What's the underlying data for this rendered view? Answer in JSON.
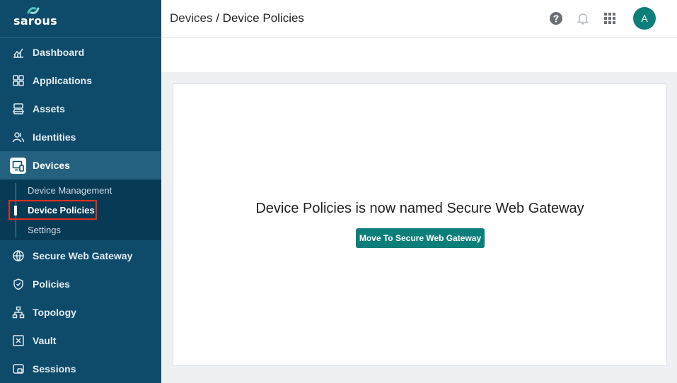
{
  "brand": {
    "name": "sarous"
  },
  "sidebar": {
    "items": [
      {
        "label": "Dashboard",
        "icon": "chart-icon"
      },
      {
        "label": "Applications",
        "icon": "grid-icon"
      },
      {
        "label": "Assets",
        "icon": "server-icon"
      },
      {
        "label": "Identities",
        "icon": "users-icon"
      },
      {
        "label": "Devices",
        "icon": "device-icon",
        "active": true
      },
      {
        "label": "Secure Web Gateway",
        "icon": "globe-icon"
      },
      {
        "label": "Policies",
        "icon": "shield-icon"
      },
      {
        "label": "Topology",
        "icon": "topology-icon"
      },
      {
        "label": "Vault",
        "icon": "vault-icon"
      },
      {
        "label": "Sessions",
        "icon": "sessions-icon"
      }
    ],
    "subitems": [
      {
        "label": "Device Management"
      },
      {
        "label": "Device Policies",
        "active": true
      },
      {
        "label": "Settings"
      }
    ]
  },
  "header": {
    "breadcrumb_parent": "Devices",
    "breadcrumb_sep": "/",
    "breadcrumb_current": "Device Policies",
    "avatar_initial": "A"
  },
  "main": {
    "message": "Device Policies is now named Secure Web Gateway",
    "button_label": "Move To Secure Web Gateway"
  },
  "colors": {
    "sidebar_bg": "#0e4b6b",
    "accent": "#0d7f7a",
    "highlight": "#e0301e"
  }
}
